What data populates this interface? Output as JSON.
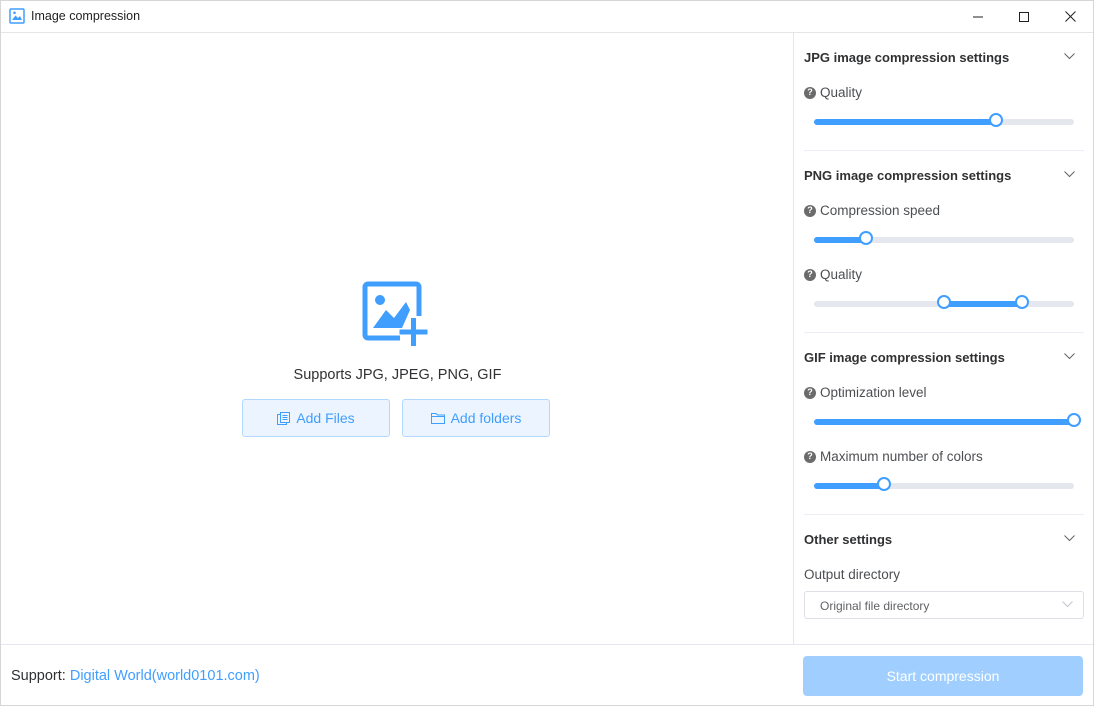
{
  "window": {
    "title": "Image compression",
    "controls": [
      "minimize-icon",
      "maximize-icon",
      "close-icon"
    ]
  },
  "main": {
    "supports_text": "Supports JPG, JPEG, PNG, GIF",
    "add_files_label": "Add Files",
    "add_folders_label": "Add folders",
    "drop_icon": "image-add-icon"
  },
  "jpg": {
    "title": "JPG image compression settings",
    "quality_label": "Quality",
    "quality_value": 0.7
  },
  "png": {
    "title": "PNG image compression settings",
    "speed_label": "Compression speed",
    "speed_value": 0.2,
    "quality_label": "Quality",
    "quality_range": [
      0.5,
      0.8
    ]
  },
  "gif": {
    "title": "GIF image compression settings",
    "optimization_label": "Optimization level",
    "optimization_value": 1.0,
    "colors_label": "Maximum number of colors",
    "colors_value": 0.27
  },
  "other": {
    "title": "Other settings",
    "output_label": "Output directory",
    "output_value": "Original file directory"
  },
  "footer": {
    "support_prefix": "Support: ",
    "support_link": "Digital World(world0101.com)",
    "start_label": "Start compression"
  },
  "colors": {
    "accent": "#409eff",
    "accent_light": "#ecf5ff",
    "start_disabled": "#a0cfff"
  }
}
